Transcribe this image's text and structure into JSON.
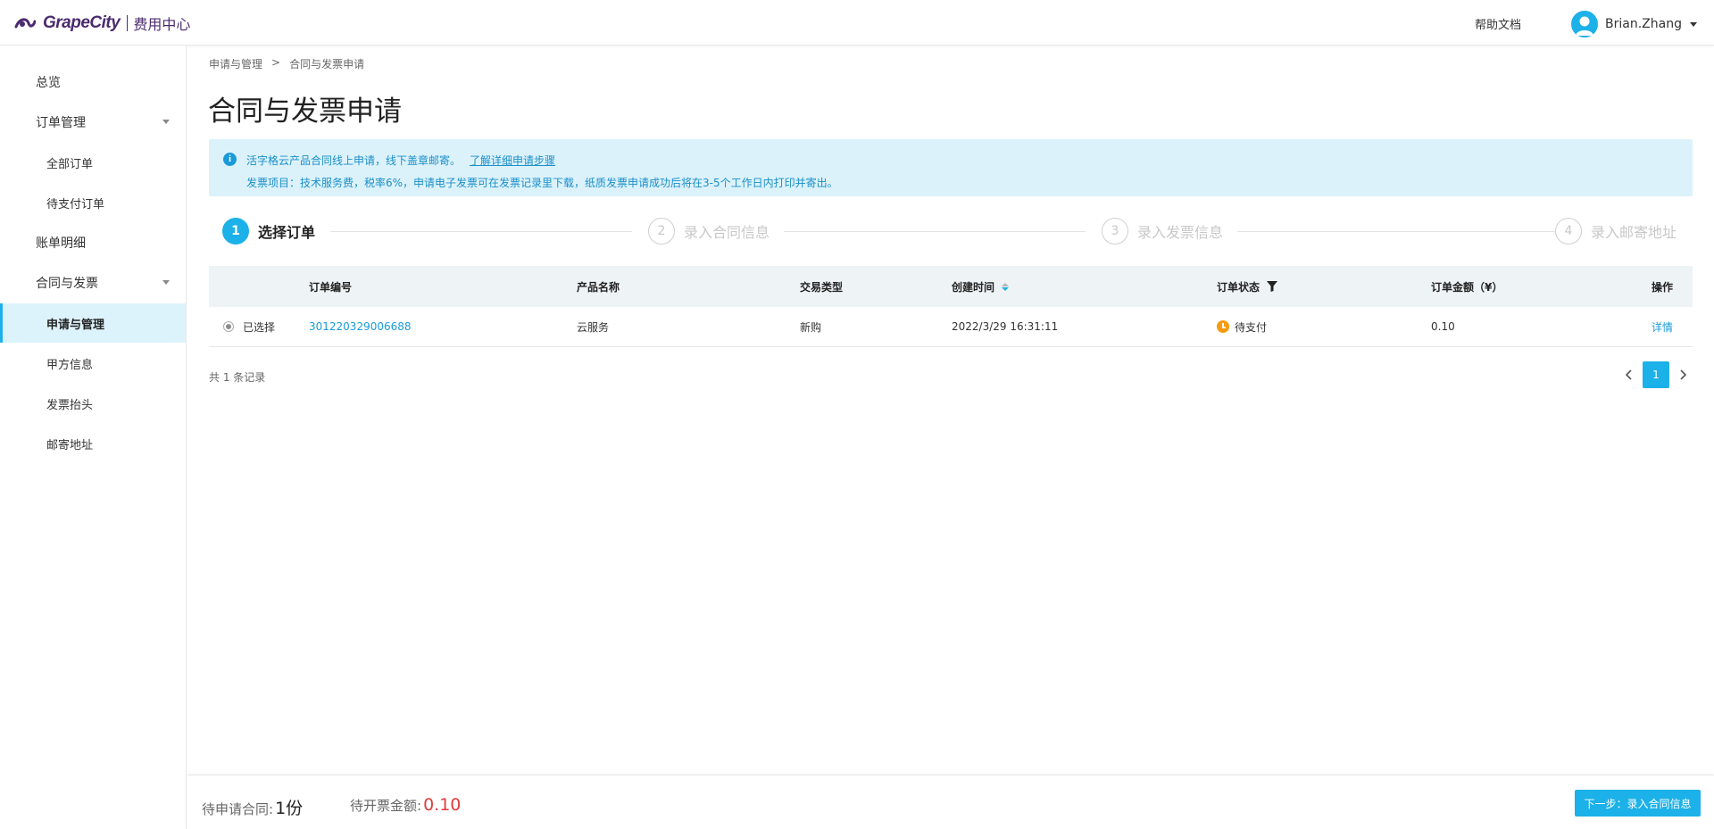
{
  "header": {
    "brand": "GrapeCity",
    "subtitle": "费用中心",
    "help_link": "帮助文档",
    "user_name": "Brian.Zhang"
  },
  "sidebar": {
    "items": [
      {
        "label": "总览"
      },
      {
        "label": "订单管理"
      },
      {
        "label": "全部订单"
      },
      {
        "label": "待支付订单"
      },
      {
        "label": "账单明细"
      },
      {
        "label": "合同与发票"
      },
      {
        "label": "申请与管理"
      },
      {
        "label": "甲方信息"
      },
      {
        "label": "发票抬头"
      },
      {
        "label": "邮寄地址"
      }
    ]
  },
  "breadcrumb": {
    "items": [
      "申请与管理",
      "合同与发票申请"
    ],
    "separator": ">"
  },
  "page_title": "合同与发票申请",
  "notice": {
    "line1": "活字格云产品合同线上申请，线下盖章邮寄。",
    "link": "了解详细申请步骤",
    "line2": "发票项目：技术服务费，税率6%，申请电子发票可在发票记录里下载，纸质发票申请成功后将在3-5个工作日内打印并寄出。"
  },
  "steps": [
    {
      "number": "1",
      "label": "选择订单",
      "active": true
    },
    {
      "number": "2",
      "label": "录入合同信息",
      "active": false
    },
    {
      "number": "3",
      "label": "录入发票信息",
      "active": false
    },
    {
      "number": "4",
      "label": "录入邮寄地址",
      "active": false
    }
  ],
  "table": {
    "headers": {
      "order_no": "订单编号",
      "product": "产品名称",
      "trade_type": "交易类型",
      "created": "创建时间",
      "status": "订单状态",
      "amount": "订单金额（¥）",
      "action": "操作"
    },
    "rows": [
      {
        "select_label": "已选择",
        "order_no": "301220329006688",
        "product": "云服务",
        "trade_type": "新购",
        "created": "2022/3/29 16:31:11",
        "status": "待支付",
        "amount": "0.10",
        "action": "详情"
      }
    ]
  },
  "record_count": "共 1 条记录",
  "pager": {
    "current": "1"
  },
  "footer": {
    "pending_contract_label": "待申请合同:",
    "pending_contract_value": "1份",
    "pending_invoice_label": "待开票金额:",
    "pending_invoice_value": "0.10",
    "next_button": "下一步：录入合同信息"
  },
  "colors": {
    "accent": "#1cb1e8",
    "brand": "#4b2b6f",
    "notice_bg": "#dcf2fb",
    "warning": "#f39c12",
    "amount_red": "#e03c3c"
  },
  "icons": {
    "logo": "grapecity-logo-icon",
    "avatar": "user-avatar-icon",
    "info": "info-icon",
    "sort": "sort-icon",
    "filter": "filter-icon",
    "status": "clock-icon",
    "prev": "chevron-left-icon",
    "next": "chevron-right-icon"
  }
}
